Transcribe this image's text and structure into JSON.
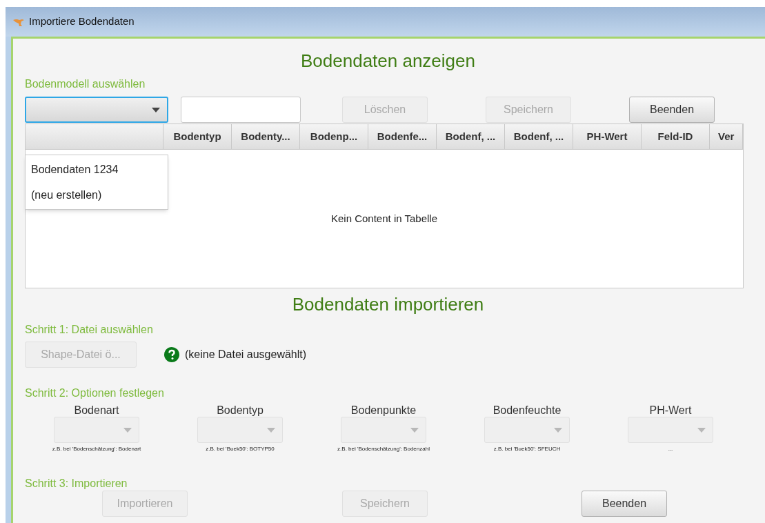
{
  "window": {
    "title": "Importiere Bodendaten"
  },
  "view": {
    "heading": "Bodendaten anzeigen",
    "model_label": "Bodenmodell auswählen",
    "model_dropdown": {
      "expanded": true,
      "options": [
        "Bodendaten 1234",
        "(neu erstellen)"
      ]
    },
    "buttons": [
      {
        "label": "Löschen",
        "disabled": true
      },
      {
        "label": "Speichern",
        "disabled": true
      },
      {
        "label": "Beenden",
        "disabled": false
      }
    ],
    "table": {
      "columns": [
        "",
        "Bodentyp",
        "Bodenty...",
        "Bodenp...",
        "Bodenfe...",
        "Bodenf, ...",
        "Bodenf, ...",
        "PH-Wert",
        "Feld-ID",
        "Ver"
      ],
      "empty_text": "Kein Content in Tabelle"
    }
  },
  "import": {
    "heading": "Bodendaten importieren",
    "step1": {
      "label": "Schritt 1: Datei auswählen",
      "button": {
        "label": "Shape-Datei ö...",
        "disabled": true
      },
      "status": "(keine Datei ausgewählt)"
    },
    "step2": {
      "label": "Schritt 2: Optionen festlegen",
      "options": [
        {
          "label": "Bodenart",
          "hint": "z.B. bei 'Bodenschätzung': Bodenart",
          "disabled": true
        },
        {
          "label": "Bodentyp",
          "hint": "z.B. bei 'Buek50': BOTYP50",
          "disabled": true
        },
        {
          "label": "Bodenpunkte",
          "hint": "z.B. bei 'Bodenschätzung': Bodenzahl",
          "disabled": true
        },
        {
          "label": "Bodenfeuchte",
          "hint": "z.B. bei 'Buek50': SFEUCH",
          "disabled": true
        },
        {
          "label": "PH-Wert",
          "hint": "...",
          "disabled": true
        }
      ]
    },
    "step3": {
      "label": "Schritt 3: Importieren",
      "buttons": [
        {
          "label": "Importieren",
          "disabled": true
        },
        {
          "label": "Speichern",
          "disabled": true
        },
        {
          "label": "Beenden",
          "disabled": false
        }
      ]
    }
  }
}
